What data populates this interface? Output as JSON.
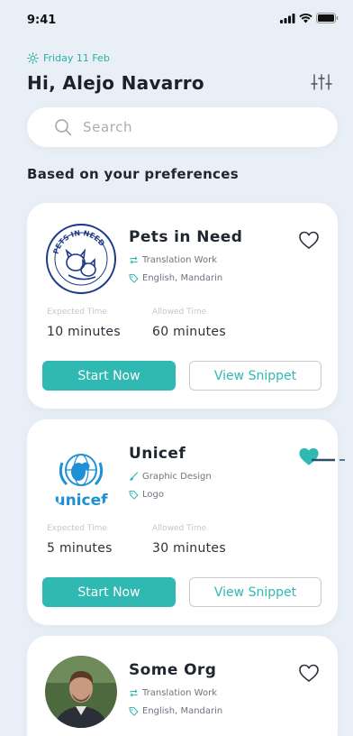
{
  "status_bar": {
    "time": "9:41"
  },
  "header": {
    "date": "Friday 11 Feb",
    "greeting": "Hi, Alejo Navarro",
    "filter_icon": "sliders-icon"
  },
  "search": {
    "placeholder": "Search"
  },
  "section_title": "Based on your preferences",
  "labels": {
    "expected": "Expected Time",
    "allowed": "Allowed Time",
    "start": "Start Now",
    "snippet": "View Snippet"
  },
  "cards": [
    {
      "name": "Pets in Need",
      "logo_text": "PETS IN NEED",
      "category": "Translation Work",
      "tags": "English, Mandarin",
      "expected_time": "10 minutes",
      "allowed_time": "60 minutes",
      "favorited": false
    },
    {
      "name": "Unicef",
      "logo_text": "unicef",
      "category": "Graphic Design",
      "tags": "Logo",
      "expected_time": "5 minutes",
      "allowed_time": "30 minutes",
      "favorited": true
    },
    {
      "name": "Some Org",
      "category": "Translation Work",
      "tags": "English, Mandarin",
      "favorited": false
    }
  ],
  "colors": {
    "accent": "#30b9b2",
    "background": "#e9eff6",
    "date": "#26b0a5"
  }
}
